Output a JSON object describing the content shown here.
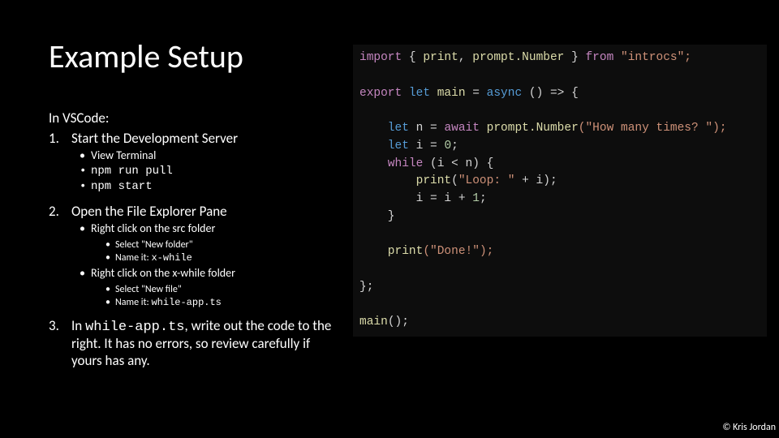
{
  "title": "Example Setup",
  "intro": "In VSCode:",
  "steps": [
    {
      "title": "Start the Development Server",
      "sub1": [
        {
          "text": "View Terminal"
        },
        {
          "text": "npm run pull",
          "mono": true
        },
        {
          "text": "npm start",
          "mono": true
        }
      ]
    },
    {
      "title": "Open the File Explorer Pane",
      "sub1": [
        {
          "text": "Right click on the src folder",
          "sub2": [
            {
              "text": "Select \"New folder\""
            },
            {
              "text_prefix": "Name it: ",
              "text_mono": "x-while"
            }
          ]
        },
        {
          "text": "Right click on the x-while folder",
          "sub2": [
            {
              "text": "Select \"New file\""
            },
            {
              "text_prefix": "Name it: ",
              "text_mono": "while-app.ts"
            }
          ]
        }
      ]
    },
    {
      "title_prefix": "In ",
      "title_mono": "while-app.ts",
      "title_suffix": ", write out the code to the right. It has no errors, so review carefully if yours has any."
    }
  ],
  "code": {
    "l1_import": "import",
    "l1_brace_open": " { ",
    "l1_print": "print",
    "l1_comma": ", ",
    "l1_prompt": "prompt.Number",
    "l1_brace_close": " } ",
    "l1_from": "from",
    "l1_str": " \"introcs\";",
    "blank1": " ",
    "l2_export": "export",
    "l2_let": " let ",
    "l2_main": "main",
    "l2_eq": " = ",
    "l2_async": "async",
    "l2_arrow": " () => {",
    "blank2": " ",
    "l3_let": "    let ",
    "l3_n": "n = ",
    "l3_await": "await",
    "l3_prompt": " prompt.Number",
    "l3_args": "(\"How many times? \");",
    "l4_let": "    let ",
    "l4_i": "i = ",
    "l4_zero": "0",
    "l4_semi": ";",
    "l5_while": "    while ",
    "l5_cond": "(i < n) {",
    "l6_print": "        print",
    "l6_args_open": "(",
    "l6_str": "\"Loop: \"",
    "l6_plus": " + i);",
    "l7": "        i = i + ",
    "l7_one": "1",
    "l7_semi": ";",
    "l8": "    }",
    "blank3": " ",
    "l9_print": "    print",
    "l9_args": "(\"Done!\");",
    "blank4": " ",
    "l10": "};",
    "blank5": " ",
    "l11_main": "main",
    "l11_call": "();"
  },
  "copyright": "© Kris Jordan"
}
